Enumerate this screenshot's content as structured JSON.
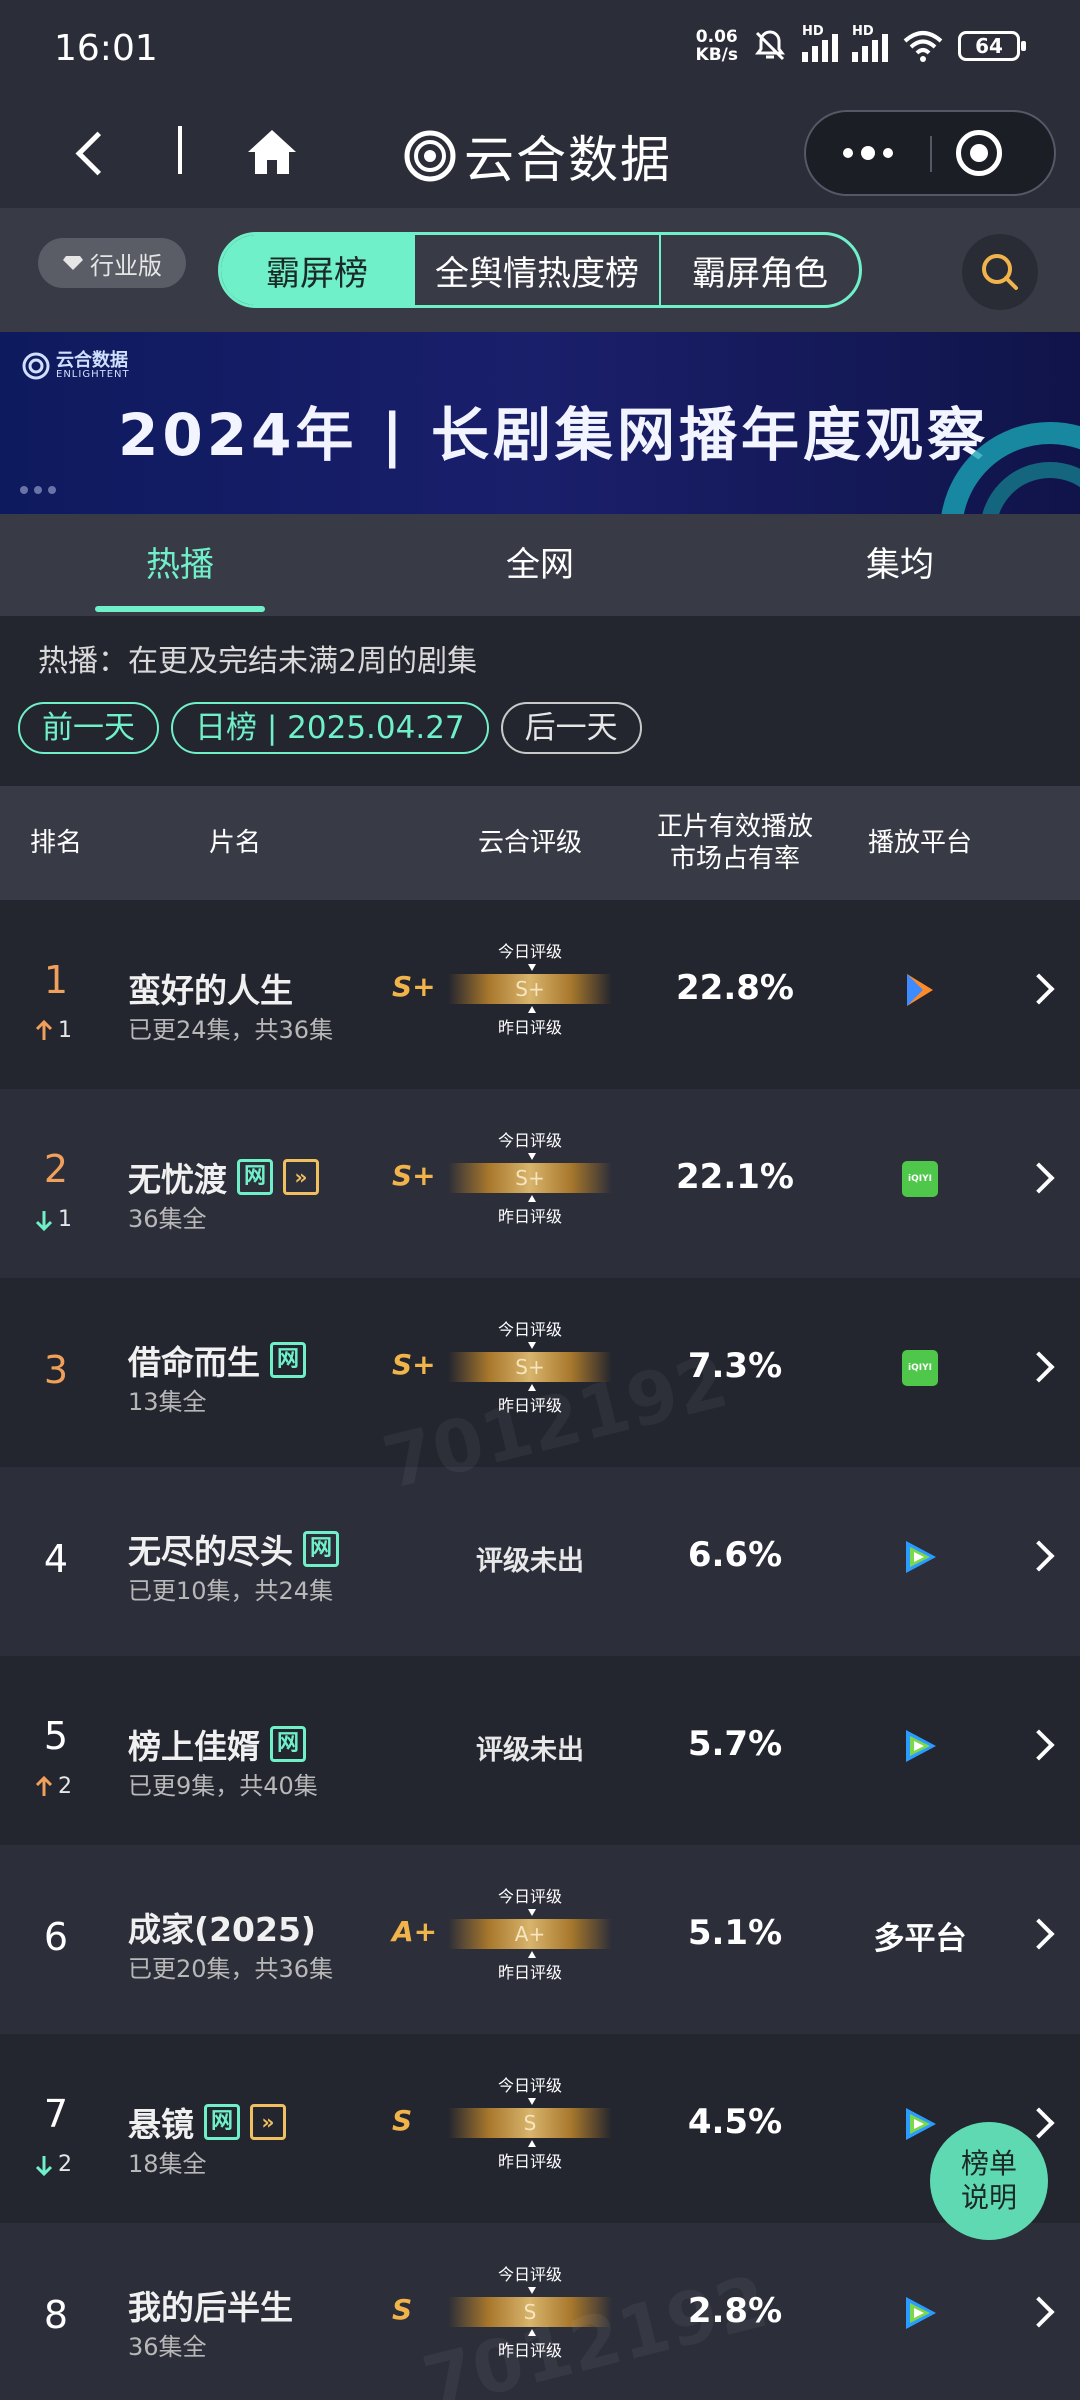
{
  "status_bar": {
    "time": "16:01",
    "net_speed": "0.06",
    "net_unit": "KB/s",
    "signal_label_1": "HD",
    "signal_label_2": "HD",
    "battery": "64"
  },
  "header": {
    "app_title": "云合数据"
  },
  "nav": {
    "edition": "行业版",
    "segments": [
      "霸屏榜",
      "全舆情热度榜",
      "霸屏角色"
    ],
    "active_segment": "霸屏榜"
  },
  "banner": {
    "logo_text": "云合数据",
    "logo_sub": "ENLIGHTENT",
    "title": "2024年 | 长剧集网播年度观察"
  },
  "sub_tabs": [
    "热播",
    "全网",
    "集均"
  ],
  "active_sub_tab": "热播",
  "description": "热播：在更及完结未满2周的剧集",
  "date_row": {
    "prev": "前一天",
    "current": "日榜 | 2025.04.27",
    "next": "后一天"
  },
  "table": {
    "headers": {
      "rank": "排名",
      "name": "片名",
      "rating": "云合评级",
      "share_line1": "正片有效播放",
      "share_line2": "市场占有率",
      "platform": "播放平台"
    },
    "rating_top_label": "今日评级",
    "rating_bottom_label": "昨日评级",
    "rows": [
      {
        "rank": "1",
        "change_dir": "up",
        "change": "1",
        "title": "蛮好的人生",
        "tags": [],
        "subtitle": "已更24集，共36集",
        "rating_letter": "S+",
        "rating_bar": "S+",
        "share": "22.8%",
        "platform": "tencent-orange"
      },
      {
        "rank": "2",
        "change_dir": "down",
        "change": "1",
        "title": "无忧渡",
        "tags": [
          "网",
          "play"
        ],
        "subtitle": "36集全",
        "rating_letter": "S+",
        "rating_bar": "S+",
        "share": "22.1%",
        "platform": "iqiyi"
      },
      {
        "rank": "3",
        "change_dir": "",
        "change": "",
        "title": "借命而生",
        "tags": [
          "网"
        ],
        "subtitle": "13集全",
        "rating_letter": "S+",
        "rating_bar": "S+",
        "share": "7.3%",
        "platform": "iqiyi"
      },
      {
        "rank": "4",
        "change_dir": "",
        "change": "",
        "title": "无尽的尽头",
        "tags": [
          "网"
        ],
        "subtitle": "已更10集，共24集",
        "rating_none": "评级未出",
        "share": "6.6%",
        "platform": "tencent"
      },
      {
        "rank": "5",
        "change_dir": "up",
        "change": "2",
        "title": "榜上佳婿",
        "tags": [
          "网"
        ],
        "subtitle": "已更9集，共40集",
        "rating_none": "评级未出",
        "share": "5.7%",
        "platform": "tencent"
      },
      {
        "rank": "6",
        "change_dir": "",
        "change": "",
        "title": "成家(2025)",
        "tags": [],
        "subtitle": "已更20集，共36集",
        "rating_letter": "A+",
        "rating_bar": "A+",
        "share": "5.1%",
        "platform_text": "多平台"
      },
      {
        "rank": "7",
        "change_dir": "down",
        "change": "2",
        "title": "悬镜",
        "tags": [
          "网",
          "play"
        ],
        "subtitle": "18集全",
        "rating_letter": "S",
        "rating_bar": "S",
        "share": "4.5%",
        "platform": "tencent"
      },
      {
        "rank": "8",
        "change_dir": "",
        "change": "",
        "title": "我的后半生",
        "tags": [],
        "subtitle": "36集全",
        "rating_letter": "S",
        "rating_bar": "S",
        "share": "2.8%",
        "platform": "tencent"
      }
    ]
  },
  "float_button": {
    "line1": "榜单",
    "line2": "说明"
  },
  "watermarks": [
    "7012192",
    "7012192"
  ],
  "platform_labels": {
    "iqiyi": "iQIYI"
  },
  "tag_wang": "网",
  "colors": {
    "accent": "#6ff0c8",
    "gold": "#f0b44a",
    "top_rank": "#f0a05a"
  }
}
